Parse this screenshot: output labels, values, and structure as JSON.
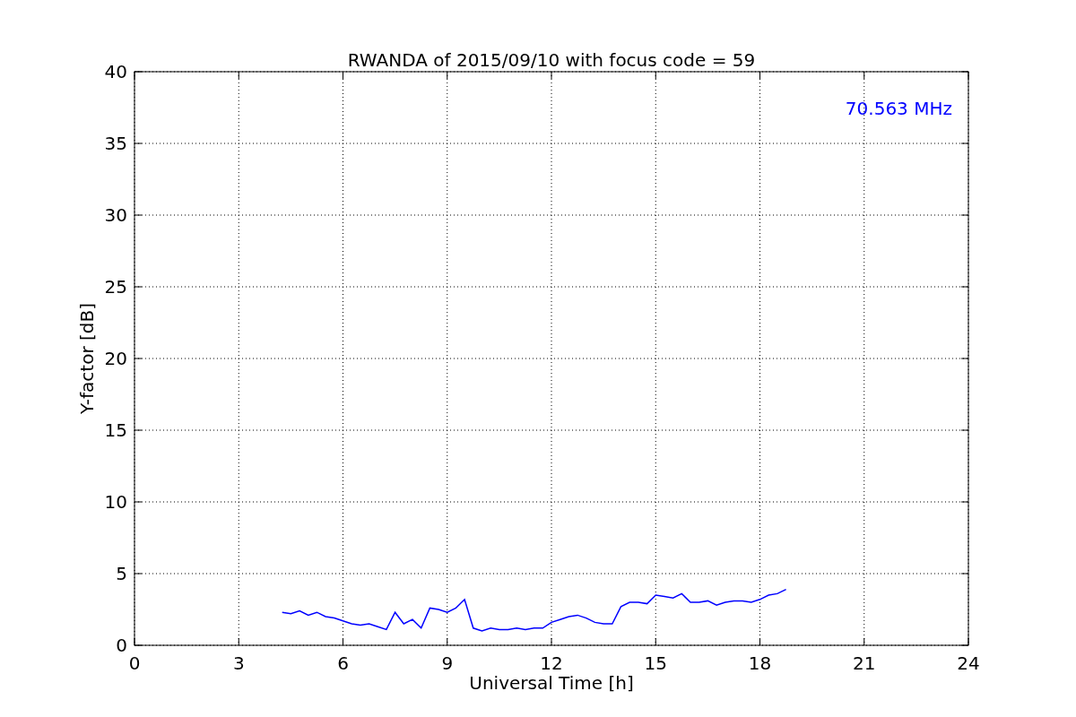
{
  "chart_data": {
    "type": "line",
    "title": "RWANDA of 2015/09/10 with focus code = 59",
    "xlabel": "Universal Time [h]",
    "ylabel": "Y-factor [dB]",
    "x": [
      4.25,
      4.5,
      4.75,
      5.0,
      5.25,
      5.5,
      5.75,
      6.0,
      6.25,
      6.5,
      6.75,
      7.0,
      7.25,
      7.5,
      7.75,
      8.0,
      8.25,
      8.5,
      8.75,
      9.0,
      9.25,
      9.5,
      9.75,
      10.0,
      10.25,
      10.5,
      10.75,
      11.0,
      11.25,
      11.5,
      11.75,
      12.0,
      12.25,
      12.5,
      12.75,
      13.0,
      13.25,
      13.5,
      13.75,
      14.0,
      14.25,
      14.5,
      14.75,
      15.0,
      15.25,
      15.5,
      15.75,
      16.0,
      16.25,
      16.5,
      16.75,
      17.0,
      17.25,
      17.5,
      17.75,
      18.0,
      18.25,
      18.5,
      18.75
    ],
    "series": [
      {
        "name": "70.563 MHz",
        "color": "#0000ff",
        "values": [
          2.3,
          2.2,
          2.4,
          2.1,
          2.3,
          2.0,
          1.9,
          1.7,
          1.5,
          1.4,
          1.5,
          1.3,
          1.1,
          2.3,
          1.5,
          1.8,
          1.2,
          2.6,
          2.5,
          2.3,
          2.6,
          3.2,
          1.2,
          1.0,
          1.2,
          1.1,
          1.1,
          1.2,
          1.1,
          1.2,
          1.2,
          1.6,
          1.8,
          2.0,
          2.1,
          1.9,
          1.6,
          1.5,
          1.5,
          2.7,
          3.0,
          3.0,
          2.9,
          3.5,
          3.4,
          3.3,
          3.6,
          3.0,
          3.0,
          3.1,
          2.8,
          3.0,
          3.1,
          3.1,
          3.0,
          3.2,
          3.5,
          3.6,
          3.9
        ]
      }
    ],
    "xlim": [
      0,
      24
    ],
    "ylim": [
      0,
      40
    ],
    "xticks": [
      0,
      3,
      6,
      9,
      12,
      15,
      18,
      21,
      24
    ],
    "yticks": [
      0,
      5,
      10,
      15,
      20,
      25,
      30,
      35,
      40
    ],
    "grid": true
  }
}
